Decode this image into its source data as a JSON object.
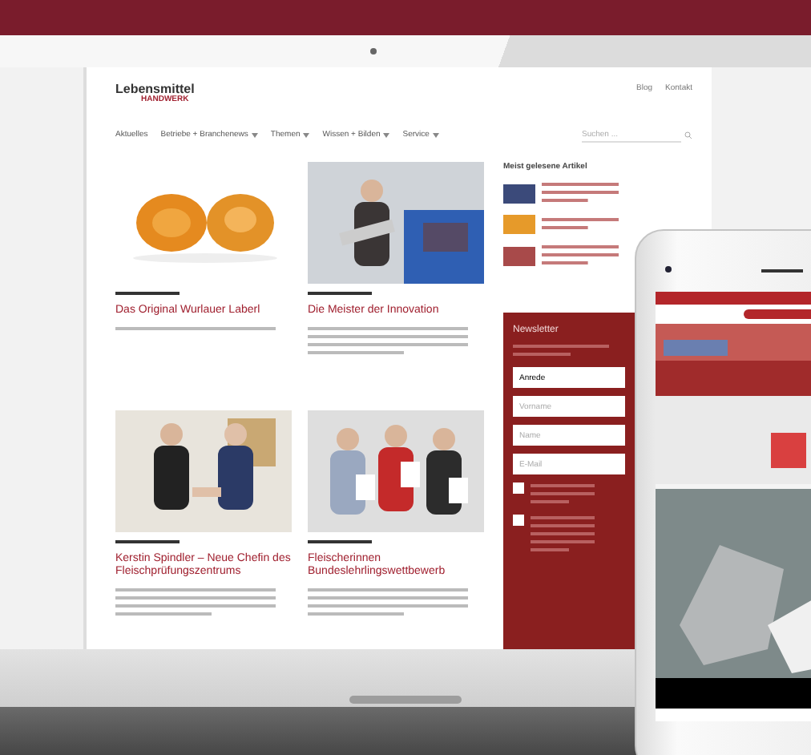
{
  "site": {
    "logo": {
      "line1": "Lebensmittel",
      "line2": "HANDWERK"
    },
    "top_links": [
      "Blog",
      "Kontakt"
    ],
    "nav": [
      {
        "label": "Aktuelles",
        "dropdown": false
      },
      {
        "label": "Betriebe + Branchenews",
        "dropdown": true
      },
      {
        "label": "Themen",
        "dropdown": true
      },
      {
        "label": "Wissen + Bilden",
        "dropdown": true
      },
      {
        "label": "Service",
        "dropdown": true
      }
    ],
    "search": {
      "placeholder": "Suchen ..."
    },
    "articles": [
      {
        "title": "Das Original Wurlauer Laberl"
      },
      {
        "title": "Die Meister der Innovation"
      },
      {
        "title": "Kerstin Spindler – Neue Chefin des Fleischprüfungszentrums"
      },
      {
        "title": "Fleischerinnen Bundeslehrlingswettbewerb"
      }
    ],
    "sidebar": {
      "title": "Meist gelesene Artikel",
      "newsletter": {
        "title": "Newsletter",
        "fields": [
          {
            "kind": "select",
            "value": "Anrede"
          },
          {
            "kind": "input",
            "placeholder": "Vorname"
          },
          {
            "kind": "input",
            "placeholder": "Name"
          },
          {
            "kind": "input",
            "placeholder": "E-Mail"
          }
        ],
        "consents": [
          {
            "checked": false
          },
          {
            "checked": false
          }
        ]
      }
    }
  }
}
